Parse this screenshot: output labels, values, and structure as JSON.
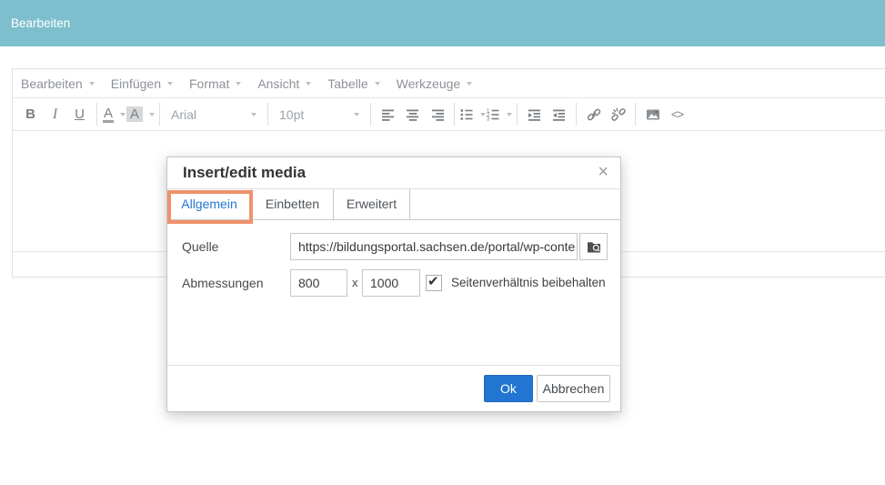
{
  "topbar": {
    "title": "Bearbeiten"
  },
  "menubar": {
    "items": [
      {
        "label": "Bearbeiten"
      },
      {
        "label": "Einfügen"
      },
      {
        "label": "Format"
      },
      {
        "label": "Ansicht"
      },
      {
        "label": "Tabelle"
      },
      {
        "label": "Werkzeuge"
      }
    ]
  },
  "toolbar": {
    "bold_label": "B",
    "italic_label": "I",
    "underline_label": "U",
    "forecolor_label": "A",
    "backcolor_label": "A",
    "font_family": "Arial",
    "font_size": "10pt",
    "code_glyph": "<>"
  },
  "dialog": {
    "title": "Insert/edit media",
    "close_glyph": "×",
    "tabs": [
      {
        "label": "Allgemein",
        "active": true
      },
      {
        "label": "Einbetten",
        "active": false
      },
      {
        "label": "Erweitert",
        "active": false
      }
    ],
    "source": {
      "label": "Quelle",
      "value": "https://bildungsportal.sachsen.de/portal/wp-conten"
    },
    "dimensions": {
      "label": "Abmessungen",
      "width": "800",
      "separator": "x",
      "height": "1000",
      "constrain_label": "Seitenverhältnis beibehalten",
      "constrain_checked": true
    },
    "buttons": {
      "ok": "Ok",
      "cancel": "Abbrechen"
    },
    "highlight_color": "#F0926C"
  },
  "icons": {
    "checkmark": "✔"
  },
  "colors": {
    "topbar_teal": "#7DBFCD",
    "accent_blue": "#2276D2",
    "active_tab_blue": "#2376D2",
    "highlight_orange": "#F0926C"
  }
}
